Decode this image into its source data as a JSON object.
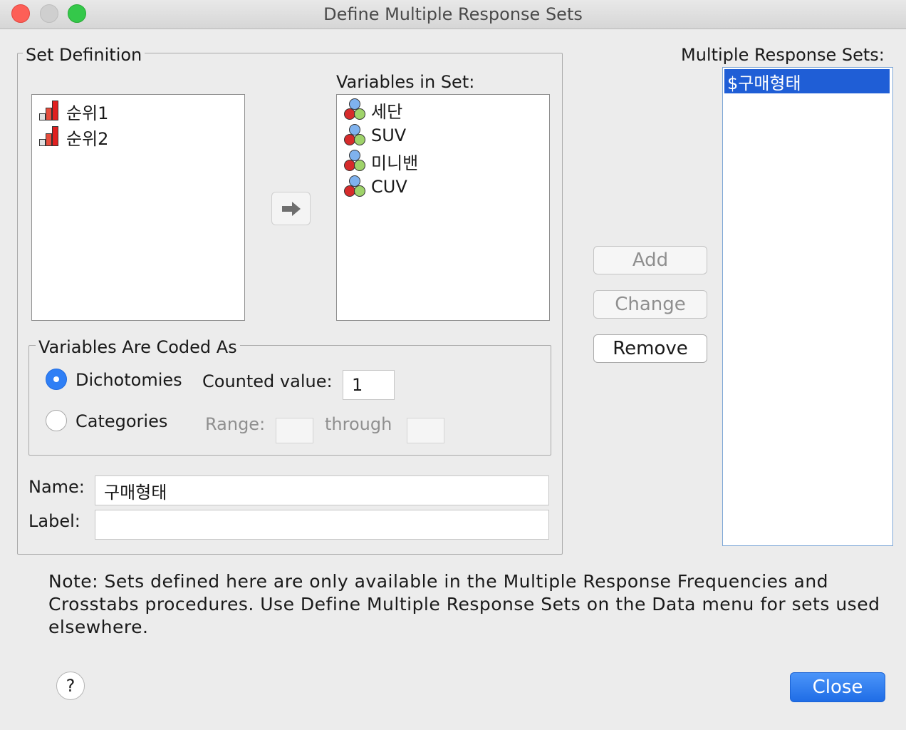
{
  "window": {
    "title": "Define Multiple Response Sets"
  },
  "set_definition": {
    "title": "Set Definition",
    "available_variables": [
      {
        "label": "순위1",
        "icon": "ordinal-bar-icon"
      },
      {
        "label": "순위2",
        "icon": "ordinal-bar-icon"
      }
    ],
    "variables_in_set_label": "Variables in Set:",
    "variables_in_set": [
      {
        "label": "세단",
        "icon": "nominal-icon"
      },
      {
        "label": "SUV",
        "icon": "nominal-icon"
      },
      {
        "label": "미니밴",
        "icon": "nominal-icon"
      },
      {
        "label": "CUV",
        "icon": "nominal-icon"
      }
    ],
    "coded_as": {
      "title": "Variables Are Coded As",
      "dichotomies_label": "Dichotomies",
      "dichotomies_selected": true,
      "counted_value_label": "Counted value:",
      "counted_value": "1",
      "categories_label": "Categories",
      "categories_selected": false,
      "range_label": "Range:",
      "through_label": "through"
    },
    "name_label": "Name:",
    "name_value": "구매형태",
    "label_label": "Label:",
    "label_value": ""
  },
  "actions": {
    "add": "Add",
    "change": "Change",
    "remove": "Remove"
  },
  "multiple_response_sets": {
    "title": "Multiple Response Sets:",
    "items": [
      "$구매형태"
    ]
  },
  "note": "Note: Sets defined here are only available in the Multiple Response Frequencies and Crosstabs procedures. Use Define Multiple Response Sets on the Data menu for sets used elsewhere.",
  "help_label": "?",
  "close_label": "Close",
  "colors": {
    "accent": "#2f7ff5",
    "selection": "#1f5ed6"
  }
}
